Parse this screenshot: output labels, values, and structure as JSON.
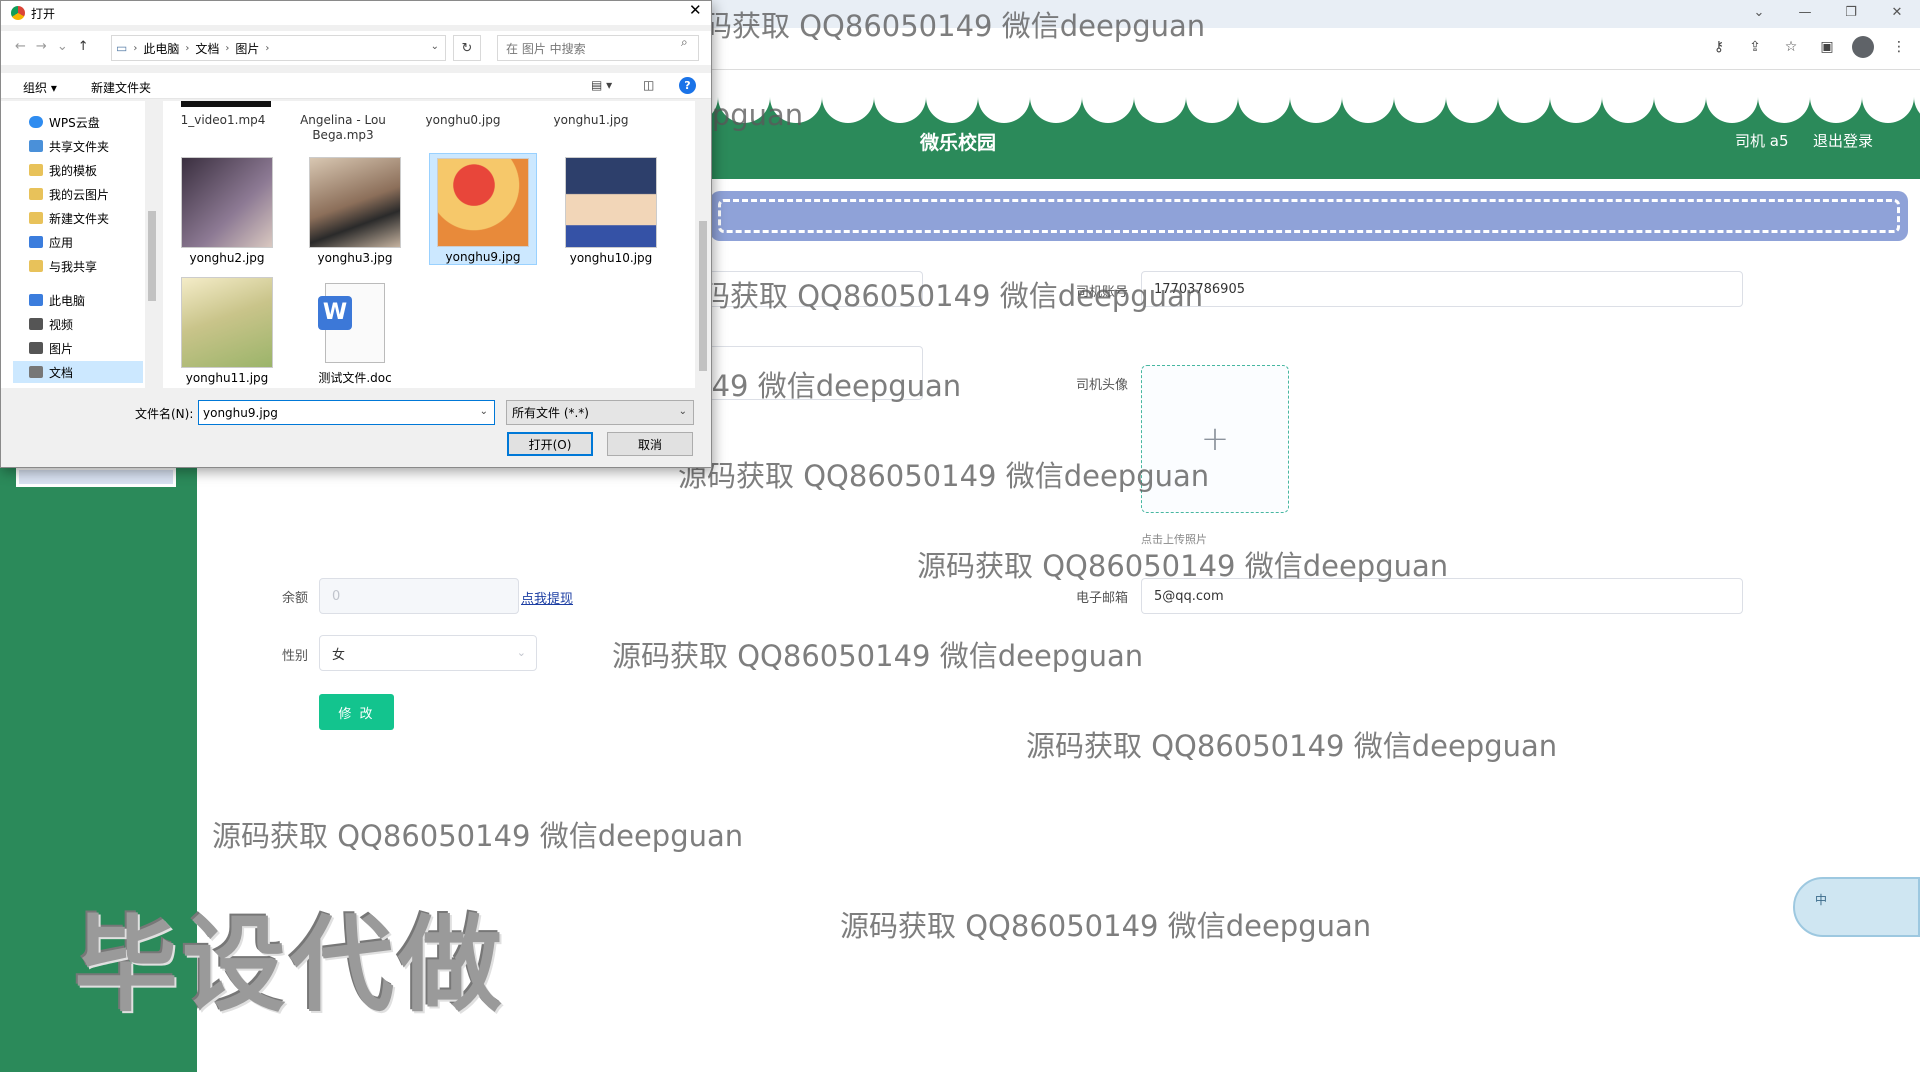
{
  "browser": {
    "window_controls": [
      "⌄",
      "—",
      "❐",
      "✕"
    ],
    "toolbar_icons": [
      "key-icon",
      "share-icon",
      "star-icon",
      "sidepanel-icon",
      "profile-icon",
      "menu-icon"
    ]
  },
  "header": {
    "site_title": "微乐校园",
    "user_name": "司机 a5",
    "logout_label": "退出登录",
    "color": "#2b8a5a"
  },
  "form": {
    "account_label": "司机账号",
    "account_value": "17703786905",
    "avatar_label": "司机头像",
    "upload_plus": "+",
    "upload_tip": "点击上传照片",
    "balance_label": "余额",
    "balance_value": "0",
    "withdraw_label": "点我提现",
    "email_label": "电子邮箱",
    "email_value": "5@qq.com",
    "gender_label": "性别",
    "gender_value": "女",
    "submit_label": "修 改",
    "button_color": "#13c48e"
  },
  "dialog": {
    "title": "打开",
    "breadcrumb": [
      "此电脑",
      "文档",
      "图片"
    ],
    "search_placeholder": "在 图片 中搜索",
    "organize_label": "组织 ▾",
    "new_folder_label": "新建文件夹",
    "help_label": "?",
    "tree_items": [
      {
        "label": "WPS云盘",
        "color": "#2f8cf0"
      },
      {
        "label": "共享文件夹",
        "color": "#4a90d9"
      },
      {
        "label": "我的模板",
        "color": "#e8c25a"
      },
      {
        "label": "我的云图片",
        "color": "#e8c25a"
      },
      {
        "label": "新建文件夹",
        "color": "#e8c25a"
      },
      {
        "label": "应用",
        "color": "#3b7ddd"
      },
      {
        "label": "与我共享",
        "color": "#e8c25a"
      },
      {
        "label": "此电脑",
        "color": "#3b7ddd"
      },
      {
        "label": "视频",
        "color": "#555555"
      },
      {
        "label": "图片",
        "color": "#555555"
      },
      {
        "label": "文档",
        "color": "#777777"
      }
    ],
    "top_row_names": [
      "1_video1.mp4",
      "Angelina - Lou Bega.mp3",
      "yonghu0.jpg",
      "yonghu1.jpg"
    ],
    "files": [
      {
        "name": "yonghu2.jpg",
        "icon": "photo-thumbnail",
        "color": "#6b5a72"
      },
      {
        "name": "yonghu3.jpg",
        "icon": "photo-thumbnail",
        "color": "#b39a84"
      },
      {
        "name": "yonghu9.jpg",
        "icon": "photo-thumbnail",
        "color": "#e88a3a"
      },
      {
        "name": "yonghu10.jpg",
        "icon": "photo-thumbnail",
        "color": "#2d3f6b"
      },
      {
        "name": "yonghu11.jpg",
        "icon": "photo-thumbnail",
        "color": "#c9c48a"
      },
      {
        "name": "测试文件.doc",
        "icon": "word-doc-icon",
        "color": "#3c78d8"
      }
    ],
    "selected_file": "yonghu9.jpg",
    "filename_label": "文件名(N):",
    "filename_value": "yonghu9.jpg",
    "filetype_value": "所有文件 (*.*)",
    "open_label": "打开(O)",
    "cancel_label": "取消"
  },
  "watermarks": {
    "text": "源码获取 QQ86050149 微信deepguan",
    "big_text": "毕设代做"
  },
  "ime": {
    "label": "中"
  }
}
